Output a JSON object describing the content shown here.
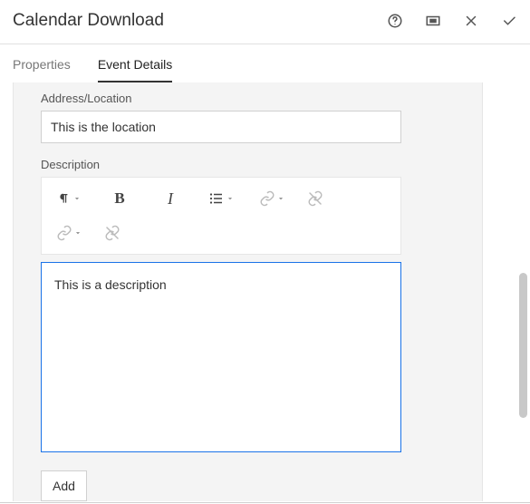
{
  "header": {
    "title": "Calendar Download"
  },
  "tabs": {
    "properties": "Properties",
    "event_details": "Event Details"
  },
  "form": {
    "address_label": "Address/Location",
    "address_value": "This is the location",
    "description_label": "Description",
    "editor_value": "This is a description",
    "add_button": "Add"
  }
}
